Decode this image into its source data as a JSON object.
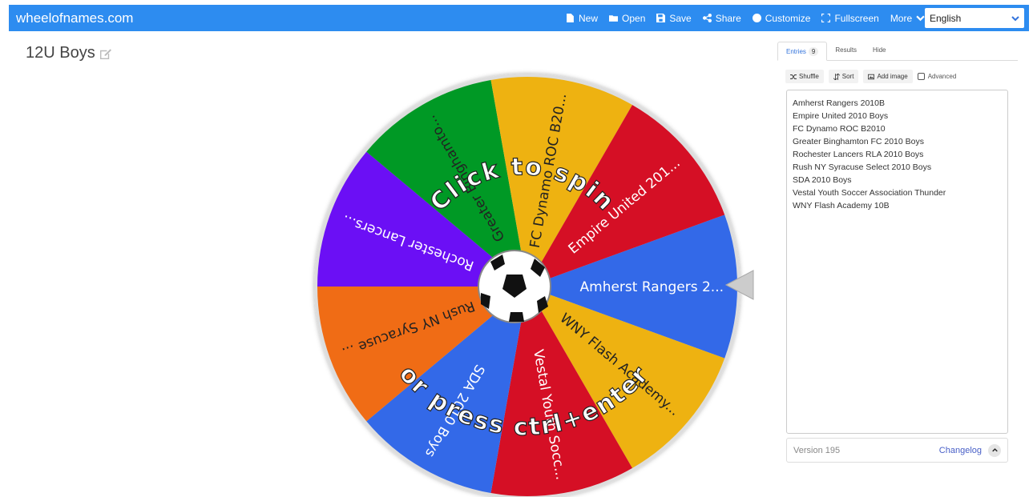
{
  "brand": "wheelofnames.com",
  "nav": {
    "new": "New",
    "open": "Open",
    "save": "Save",
    "share": "Share",
    "customize": "Customize",
    "fullscreen": "Fullscreen",
    "more": "More",
    "language": "English"
  },
  "title": "12U Boys",
  "wheel": {
    "spin_text_top": "Click to spin",
    "spin_text_bottom": "or press ctrl+enter",
    "center_icon": "soccer-ball",
    "segments": [
      {
        "label": "Amherst Rangers 2...",
        "color": "#3369e8"
      },
      {
        "label": "WNY Flash Academy...",
        "color": "#eeb211"
      },
      {
        "label": "Vestal Youth Socc...",
        "color": "#d50f25"
      },
      {
        "label": "SDA 2010 Boys",
        "color": "#3369e8"
      },
      {
        "label": "Rush NY Syracuse ...",
        "color": "#f06c15"
      },
      {
        "label": "Rochester Lancers...",
        "color": "#6b0ff5"
      },
      {
        "label": "Greater Binghamto...",
        "color": "#009925"
      },
      {
        "label": "FC Dynamo ROC B20...",
        "color": "#eeb211"
      },
      {
        "label": "Empire United 201...",
        "color": "#d50f25"
      }
    ]
  },
  "panel": {
    "tabs": {
      "entries": "Entries",
      "entries_count": "9",
      "results": "Results",
      "hide": "Hide"
    },
    "toolbar": {
      "shuffle": "Shuffle",
      "sort": "Sort",
      "add_image": "Add image",
      "advanced": "Advanced"
    },
    "entries": [
      "Amherst Rangers 2010B",
      "Empire United 2010 Boys",
      "FC Dynamo ROC B2010",
      "Greater Binghamton FC 2010 Boys",
      "Rochester Lancers RLA 2010 Boys",
      "Rush NY Syracuse Select 2010 Boys",
      "SDA 2010 Boys",
      "Vestal Youth Soccer Association Thunder",
      "WNY Flash Academy 10B"
    ],
    "version": "Version 195",
    "changelog": "Changelog"
  }
}
